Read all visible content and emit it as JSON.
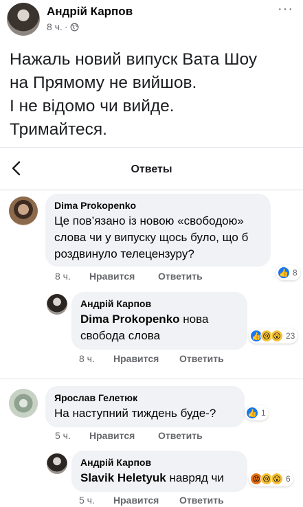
{
  "post": {
    "author": "Андрій Карпов",
    "time": "8 ч.",
    "separator": "·",
    "text_lines": [
      "Нажаль новий випуск Вата Шоу",
      "на Прямому не вийшов.",
      "І не відомо чи вийде.",
      "Тримайтеся."
    ]
  },
  "replies": {
    "title": "Ответы"
  },
  "labels": {
    "like": "Нравится",
    "reply": "Ответить"
  },
  "comments": [
    {
      "author": "Dima Prokopenko",
      "text": "Це пов’язано із новою «свободою» слова чи у випуску щось було, що б роздвинуло телецензуру?",
      "time": "8 ч.",
      "reaction_count": "8"
    },
    {
      "author": "Андрій Карпов",
      "mention": "Dima Prokopenko",
      "text": "нова свобода слова",
      "time": "8 ч.",
      "reaction_count": "23"
    },
    {
      "author": "Ярослав Гелетюк",
      "text": "На наступний тиждень буде-?",
      "time": "5 ч.",
      "reaction_count": "1"
    },
    {
      "author": "Андрій Карпов",
      "mention": "Slavik Heletyuk",
      "text": "навряд чи",
      "time": "5 ч.",
      "reaction_count": "6"
    }
  ],
  "colors": {
    "like_blue": "#1877f2",
    "meta_gray": "#65676b",
    "bubble_bg": "#f0f2f5"
  },
  "icons": [
    "globe-icon",
    "more-icon",
    "back-icon",
    "like-icon",
    "sad-icon",
    "wow-icon",
    "angry-icon"
  ]
}
